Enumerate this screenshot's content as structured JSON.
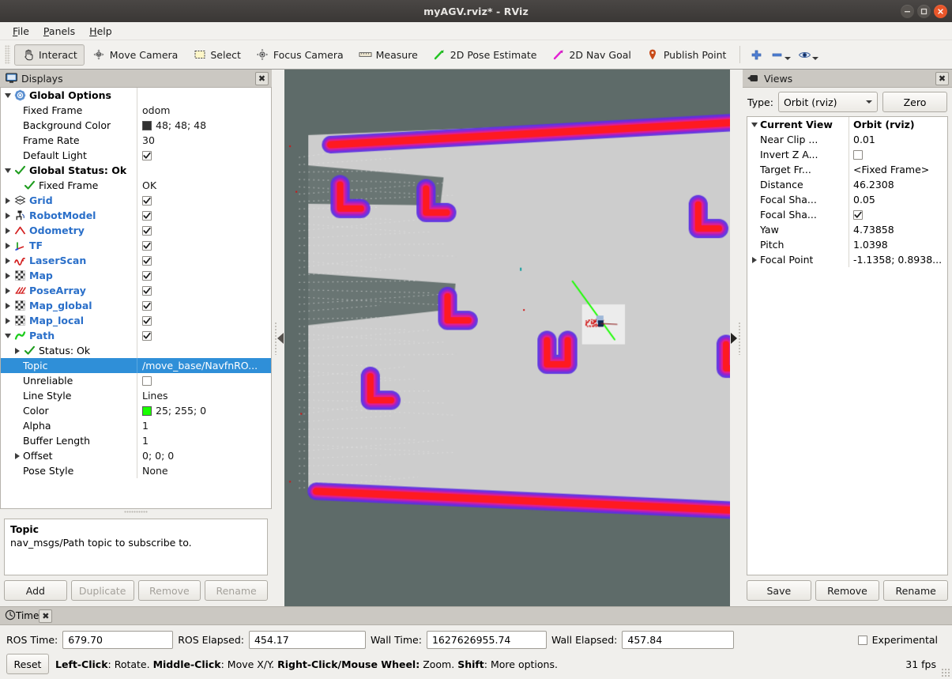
{
  "window": {
    "title": "myAGV.rviz* - RViz",
    "controls": [
      "minimize-button",
      "maximize-button",
      "close-button"
    ]
  },
  "menubar": {
    "items": [
      {
        "label": "File",
        "mnemonic": "F"
      },
      {
        "label": "Panels",
        "mnemonic": "P"
      },
      {
        "label": "Help",
        "mnemonic": "H"
      }
    ]
  },
  "toolbar": {
    "buttons": [
      {
        "label": "Interact",
        "icon": "hand-cursor-icon",
        "active": true
      },
      {
        "label": "Move Camera",
        "icon": "move-camera-icon",
        "active": false
      },
      {
        "label": "Select",
        "icon": "select-rectangle-icon",
        "active": false
      },
      {
        "label": "Focus Camera",
        "icon": "focus-camera-icon",
        "active": false
      },
      {
        "label": "Measure",
        "icon": "ruler-icon",
        "active": false
      },
      {
        "label": "2D Pose Estimate",
        "icon": "green-arrow-icon",
        "active": false
      },
      {
        "label": "2D Nav Goal",
        "icon": "magenta-arrow-icon",
        "active": false
      },
      {
        "label": "Publish Point",
        "icon": "map-pin-icon",
        "active": false
      }
    ],
    "extra": [
      {
        "icon": "plus-icon",
        "has_dropdown": false
      },
      {
        "icon": "minus-icon",
        "has_dropdown": true
      },
      {
        "icon": "eye-icon",
        "has_dropdown": true
      }
    ]
  },
  "displays": {
    "panel_title": "Displays",
    "panel_icon": "monitor-icon",
    "close_label": "✖",
    "rows": [
      {
        "indent": 0,
        "tri": "open",
        "icon": "gear-icon",
        "name": "Global Options",
        "style": "bold",
        "value_type": "none",
        "value": ""
      },
      {
        "indent": 1,
        "tri": "none",
        "icon": "none",
        "name": "Fixed Frame",
        "style": "plain",
        "value_type": "text",
        "value": "odom"
      },
      {
        "indent": 1,
        "tri": "none",
        "icon": "none",
        "name": "Background Color",
        "style": "plain",
        "value_type": "color",
        "value": "48; 48; 48",
        "swatch": "#303030"
      },
      {
        "indent": 1,
        "tri": "none",
        "icon": "none",
        "name": "Frame Rate",
        "style": "plain",
        "value_type": "text",
        "value": "30"
      },
      {
        "indent": 1,
        "tri": "none",
        "icon": "none",
        "name": "Default Light",
        "style": "plain",
        "value_type": "checked",
        "value": ""
      },
      {
        "indent": 0,
        "tri": "open",
        "icon": "check-icon",
        "name": "Global Status: Ok",
        "style": "bold",
        "value_type": "none",
        "value": ""
      },
      {
        "indent": 1,
        "tri": "none",
        "icon": "check-icon",
        "name": "Fixed Frame",
        "style": "plain",
        "value_type": "text",
        "value": "OK"
      },
      {
        "indent": 0,
        "tri": "closed",
        "icon": "grid-icon",
        "name": "Grid",
        "style": "link",
        "value_type": "checked",
        "value": ""
      },
      {
        "indent": 0,
        "tri": "closed",
        "icon": "robot-icon",
        "name": "RobotModel",
        "style": "link",
        "value_type": "checked",
        "value": ""
      },
      {
        "indent": 0,
        "tri": "closed",
        "icon": "odometry-icon",
        "name": "Odometry",
        "style": "link",
        "value_type": "checked",
        "value": ""
      },
      {
        "indent": 0,
        "tri": "closed",
        "icon": "tf-axes-icon",
        "name": "TF",
        "style": "link",
        "value_type": "checked",
        "value": ""
      },
      {
        "indent": 0,
        "tri": "closed",
        "icon": "laserscan-icon",
        "name": "LaserScan",
        "style": "link",
        "value_type": "checked",
        "value": ""
      },
      {
        "indent": 0,
        "tri": "closed",
        "icon": "map-icon",
        "name": "Map",
        "style": "link",
        "value_type": "checked",
        "value": ""
      },
      {
        "indent": 0,
        "tri": "closed",
        "icon": "posearray-icon",
        "name": "PoseArray",
        "style": "link",
        "value_type": "checked",
        "value": ""
      },
      {
        "indent": 0,
        "tri": "closed",
        "icon": "map-icon",
        "name": "Map_global",
        "style": "link",
        "value_type": "checked",
        "value": ""
      },
      {
        "indent": 0,
        "tri": "closed",
        "icon": "map-icon",
        "name": "Map_local",
        "style": "link",
        "value_type": "checked",
        "value": ""
      },
      {
        "indent": 0,
        "tri": "open",
        "icon": "path-icon",
        "name": "Path",
        "style": "link",
        "value_type": "checked",
        "value": ""
      },
      {
        "indent": 1,
        "tri": "closed",
        "icon": "check-icon",
        "name": "Status: Ok",
        "style": "plain",
        "value_type": "none",
        "value": ""
      },
      {
        "indent": 1,
        "tri": "none",
        "icon": "none",
        "name": "Topic",
        "style": "plain",
        "value_type": "text",
        "value": "/move_base/NavfnRO...",
        "selected": true
      },
      {
        "indent": 1,
        "tri": "none",
        "icon": "none",
        "name": "Unreliable",
        "style": "plain",
        "value_type": "unchecked",
        "value": ""
      },
      {
        "indent": 1,
        "tri": "none",
        "icon": "none",
        "name": "Line Style",
        "style": "plain",
        "value_type": "text",
        "value": "Lines"
      },
      {
        "indent": 1,
        "tri": "none",
        "icon": "none",
        "name": "Color",
        "style": "plain",
        "value_type": "color",
        "value": "25; 255; 0",
        "swatch": "#19ff00"
      },
      {
        "indent": 1,
        "tri": "none",
        "icon": "none",
        "name": "Alpha",
        "style": "plain",
        "value_type": "text",
        "value": "1"
      },
      {
        "indent": 1,
        "tri": "none",
        "icon": "none",
        "name": "Buffer Length",
        "style": "plain",
        "value_type": "text",
        "value": "1"
      },
      {
        "indent": 1,
        "tri": "closed",
        "icon": "none",
        "name": "Offset",
        "style": "plain",
        "value_type": "text",
        "value": "0; 0; 0"
      },
      {
        "indent": 1,
        "tri": "none",
        "icon": "none",
        "name": "Pose Style",
        "style": "plain",
        "value_type": "text",
        "value": "None"
      }
    ],
    "description": {
      "title": "Topic",
      "text": "nav_msgs/Path topic to subscribe to."
    },
    "buttons": [
      {
        "label": "Add",
        "disabled": false
      },
      {
        "label": "Duplicate",
        "disabled": true
      },
      {
        "label": "Remove",
        "disabled": true
      },
      {
        "label": "Rename",
        "disabled": true
      }
    ]
  },
  "views": {
    "panel_title": "Views",
    "panel_icon": "camera-icon",
    "close_label": "✖",
    "type_label": "Type:",
    "type_value": "Orbit (rviz)",
    "zero_label": "Zero",
    "rows": [
      {
        "indent": 0,
        "tri": "open",
        "name": "Current View",
        "style": "bold",
        "value_type": "text",
        "value": "Orbit (rviz)"
      },
      {
        "indent": 1,
        "tri": "none",
        "name": "Near Clip ...",
        "style": "plain",
        "value_type": "text",
        "value": "0.01"
      },
      {
        "indent": 1,
        "tri": "none",
        "name": "Invert Z A...",
        "style": "plain",
        "value_type": "unchecked",
        "value": ""
      },
      {
        "indent": 1,
        "tri": "none",
        "name": "Target Fr...",
        "style": "plain",
        "value_type": "text",
        "value": "<Fixed Frame>"
      },
      {
        "indent": 1,
        "tri": "none",
        "name": "Distance",
        "style": "plain",
        "value_type": "text",
        "value": "46.2308"
      },
      {
        "indent": 1,
        "tri": "none",
        "name": "Focal Sha...",
        "style": "plain",
        "value_type": "text",
        "value": "0.05"
      },
      {
        "indent": 1,
        "tri": "none",
        "name": "Focal Sha...",
        "style": "plain",
        "value_type": "checked",
        "value": ""
      },
      {
        "indent": 1,
        "tri": "none",
        "name": "Yaw",
        "style": "plain",
        "value_type": "text",
        "value": "4.73858"
      },
      {
        "indent": 1,
        "tri": "none",
        "name": "Pitch",
        "style": "plain",
        "value_type": "text",
        "value": "1.0398"
      },
      {
        "indent": 1,
        "tri": "closed",
        "name": "Focal Point",
        "style": "plain",
        "value_type": "text",
        "value": "-1.1358; 0.8938..."
      }
    ],
    "buttons": [
      {
        "label": "Save",
        "disabled": false
      },
      {
        "label": "Remove",
        "disabled": false
      },
      {
        "label": "Rename",
        "disabled": false
      }
    ]
  },
  "render_view": {
    "background_color": "#5e6b69",
    "free_space_color": "#cdcdcd",
    "local_costmap_color": "#ececec",
    "path_color": "#19ff00",
    "inflation_colors": [
      "#ff1a1a",
      "#e02090",
      "#a020c8",
      "#6030e0"
    ]
  },
  "time_panel": {
    "panel_title": "Time",
    "panel_icon": "clock-icon",
    "close_label": "✖",
    "fields": [
      {
        "label": "ROS Time:",
        "value": "679.70"
      },
      {
        "label": "ROS Elapsed:",
        "value": "454.17"
      },
      {
        "label": "Wall Time:",
        "value": "1627626955.74"
      },
      {
        "label": "Wall Elapsed:",
        "value": "457.84"
      }
    ],
    "experimental_label": "Experimental",
    "experimental_checked": false
  },
  "statusbar": {
    "reset_label": "Reset",
    "hint_parts": [
      {
        "text": "Left-Click",
        "bold": true
      },
      {
        "text": ": Rotate.  ",
        "bold": false
      },
      {
        "text": "Middle-Click",
        "bold": true
      },
      {
        "text": ": Move X/Y.  ",
        "bold": false
      },
      {
        "text": "Right-Click/Mouse Wheel:",
        "bold": true
      },
      {
        "text": " Zoom.  ",
        "bold": false
      },
      {
        "text": "Shift",
        "bold": true
      },
      {
        "text": ": More options.",
        "bold": false
      }
    ],
    "fps": "31 fps"
  }
}
